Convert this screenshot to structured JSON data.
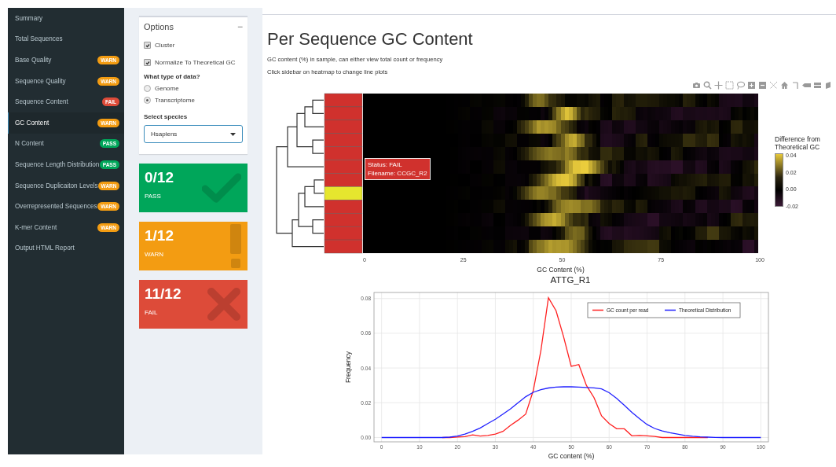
{
  "sidebar": {
    "items": [
      {
        "label": "Summary",
        "selected": false
      },
      {
        "label": "Total Sequences",
        "selected": false
      },
      {
        "label": "Base Quality",
        "selected": false,
        "badge": "WARN",
        "color": "#f39c12"
      },
      {
        "label": "Sequence Quality",
        "selected": false,
        "badge": "WARN",
        "color": "#f39c12"
      },
      {
        "label": "Sequence Content",
        "selected": false,
        "badge": "FAIL",
        "color": "#dd4b39"
      },
      {
        "label": "GC Content",
        "selected": true,
        "badge": "WARN",
        "color": "#f39c12"
      },
      {
        "label": "N Content",
        "selected": false,
        "badge": "PASS",
        "color": "#00a65a"
      },
      {
        "label": "Sequence Length Distribution",
        "selected": false,
        "badge": "PASS",
        "color": "#00a65a"
      },
      {
        "label": "Sequence Duplicaiton Levels",
        "selected": false,
        "badge": "WARN",
        "color": "#f39c12"
      },
      {
        "label": "Overrepresented Sequences",
        "selected": false,
        "badge": "WARN",
        "color": "#f39c12"
      },
      {
        "label": "K-mer Content",
        "selected": false,
        "badge": "WARN",
        "color": "#f39c12"
      },
      {
        "label": "Output HTML Report",
        "selected": false
      }
    ]
  },
  "options": {
    "title": "Options",
    "collapse": "−",
    "checkboxes": [
      {
        "label": "Cluster",
        "checked": true
      },
      {
        "label": "Normalize To Theoretical GC",
        "checked": true
      }
    ],
    "data_type": {
      "label": "What type of data?",
      "choices": [
        {
          "label": "Genome",
          "selected": false
        },
        {
          "label": "Transcriptome",
          "selected": true
        }
      ]
    },
    "species": {
      "label": "Select species",
      "value": "Hsapiens"
    }
  },
  "stat_cards": [
    {
      "kind": "pass",
      "value": "0/12",
      "label": "PASS"
    },
    {
      "kind": "warn",
      "value": "1/12",
      "label": "WARN"
    },
    {
      "kind": "fail",
      "value": "11/12",
      "label": "FAIL"
    }
  ],
  "main": {
    "title": "Per Sequence GC Content",
    "descriptions": [
      "GC content (%) in sample, can either view total count or frequency",
      "Click sidebar on heatmap to change line plots"
    ],
    "heatmap": {
      "status_rows": [
        {
          "color": "#d0312d"
        },
        {
          "color": "#d0312d"
        },
        {
          "color": "#d0312d"
        },
        {
          "color": "#d0312d"
        },
        {
          "color": "#d0312d"
        },
        {
          "color": "#d0312d"
        },
        {
          "color": "#d0312d"
        },
        {
          "color": "#e6e62e"
        },
        {
          "color": "#d0312d"
        },
        {
          "color": "#d0312d"
        },
        {
          "color": "#d0312d"
        },
        {
          "color": "#d0312d"
        }
      ],
      "tooltip": [
        "Status: FAIL",
        "Filename: CCGC_R2"
      ],
      "x_ticks": [
        "0",
        "25",
        "50",
        "75",
        "100"
      ],
      "x_label": "GC Content (%)",
      "legend": {
        "title": "Difference from Theoretical GC",
        "ticks": [
          "0.04",
          "0.02",
          "0.00",
          "-0.02"
        ]
      }
    },
    "line_chart": {
      "chart_data": {
        "type": "line",
        "title": "ATTG_R1",
        "xlabel": "GC content (%)",
        "ylabel": "Frequency",
        "x": [
          0,
          2,
          4,
          6,
          8,
          10,
          12,
          14,
          16,
          18,
          20,
          22,
          24,
          26,
          28,
          30,
          32,
          34,
          36,
          38,
          40,
          42,
          44,
          46,
          48,
          50,
          52,
          54,
          56,
          58,
          60,
          62,
          64,
          66,
          68,
          70,
          72,
          74,
          76,
          78,
          80,
          82,
          84,
          86,
          88,
          90,
          92,
          94,
          96,
          98,
          100
        ],
        "series": [
          {
            "name": "GC count per read",
            "color": "#ff2020",
            "values": [
              null,
              null,
              null,
              null,
              null,
              null,
              null,
              null,
              0,
              0,
              0.0003,
              0.0005,
              0.0015,
              0.0008,
              0.0012,
              0.002,
              0.0035,
              0.007,
              0.01,
              0.0135,
              0.027,
              0.05,
              0.0805,
              0.073,
              0.058,
              0.041,
              0.042,
              0.03,
              0.023,
              0.0125,
              0.008,
              0.005,
              0.005,
              0.001,
              0.0012,
              0.001,
              0.0006,
              0,
              0,
              0,
              0,
              0,
              0,
              0,
              null,
              null,
              null,
              null,
              null,
              null,
              null
            ]
          },
          {
            "name": "Theoretical Distribution",
            "color": "#2020ff",
            "values": [
              0,
              0,
              0,
              0,
              0,
              0,
              0,
              0,
              0,
              0.0002,
              0.0008,
              0.002,
              0.0035,
              0.0055,
              0.008,
              0.0105,
              0.0135,
              0.0165,
              0.02,
              0.0235,
              0.026,
              0.0275,
              0.0285,
              0.029,
              0.0292,
              0.0292,
              0.029,
              0.0288,
              0.0286,
              0.028,
              0.0258,
              0.0225,
              0.0185,
              0.0145,
              0.0108,
              0.0075,
              0.0052,
              0.0038,
              0.0028,
              0.002,
              0.0012,
              0.0007,
              0.0004,
              0.0002,
              0.0001,
              0,
              0,
              0,
              0,
              0,
              0
            ]
          }
        ],
        "grid": true,
        "legend": true,
        "xlim": [
          -2,
          102
        ],
        "ylim": [
          -0.0025,
          0.0835
        ],
        "xticks": [
          {
            "value": 0,
            "label": "0"
          },
          {
            "value": 10,
            "label": "10"
          },
          {
            "value": 20,
            "label": "20"
          },
          {
            "value": 30,
            "label": "30"
          },
          {
            "value": 40,
            "label": "40"
          },
          {
            "value": 50,
            "label": "50"
          },
          {
            "value": 60,
            "label": "60"
          },
          {
            "value": 70,
            "label": "70"
          },
          {
            "value": 80,
            "label": "80"
          },
          {
            "value": 90,
            "label": "90"
          },
          {
            "value": 100,
            "label": "100"
          }
        ],
        "yticks": [
          {
            "value": 0,
            "label": "0.00"
          },
          {
            "value": 0.02,
            "label": "0.02"
          },
          {
            "value": 0.04,
            "label": "0.04"
          },
          {
            "value": 0.06,
            "label": "0.06"
          },
          {
            "value": 0.08,
            "label": "0.08"
          }
        ]
      }
    }
  }
}
